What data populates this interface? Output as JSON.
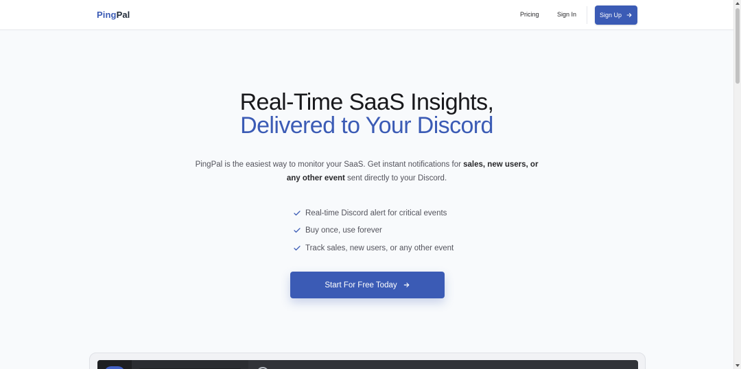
{
  "header": {
    "logo_ping": "Ping",
    "logo_pal": "Pal",
    "nav": {
      "pricing": "Pricing",
      "sign_in": "Sign In"
    },
    "signup_label": "Sign Up"
  },
  "hero": {
    "headline_line1": "Real-Time SaaS Insights,",
    "headline_line2": "Delivered to Your Discord",
    "subtitle": {
      "part1": "PingPal is the easiest way to monitor your SaaS. Get instant notifications for ",
      "bold1": "sales, new users, or",
      "bold2": "any other event",
      "part2": " sent directly to your Discord."
    },
    "features": [
      "Real-time Discord alert for critical events",
      "Buy once, use forever",
      "Track sales, new users, or any other event"
    ],
    "cta_label": "Start For Free Today"
  },
  "colors": {
    "accent": "#3b5bb5",
    "background": "#f8fafc",
    "text": "#18181b"
  },
  "icons": [
    "arrow-right-icon",
    "check-icon"
  ]
}
